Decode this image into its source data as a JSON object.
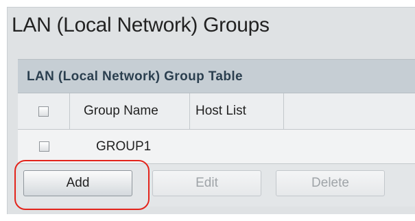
{
  "page": {
    "title": "LAN (Local Network) Groups"
  },
  "table": {
    "caption": "LAN (Local Network) Group Table",
    "columns": [
      "Group Name",
      "Host List"
    ],
    "rows": [
      {
        "group_name": "GROUP1",
        "host_list": "",
        "checked": false
      }
    ],
    "select_all_checked": false
  },
  "buttons": {
    "add": {
      "label": "Add",
      "enabled": true
    },
    "edit": {
      "label": "Edit",
      "enabled": false
    },
    "delete": {
      "label": "Delete",
      "enabled": false
    }
  },
  "colors": {
    "highlight": "#e3241b",
    "caption_text": "#2b3f4f",
    "disabled_text": "#9fa4a8"
  }
}
